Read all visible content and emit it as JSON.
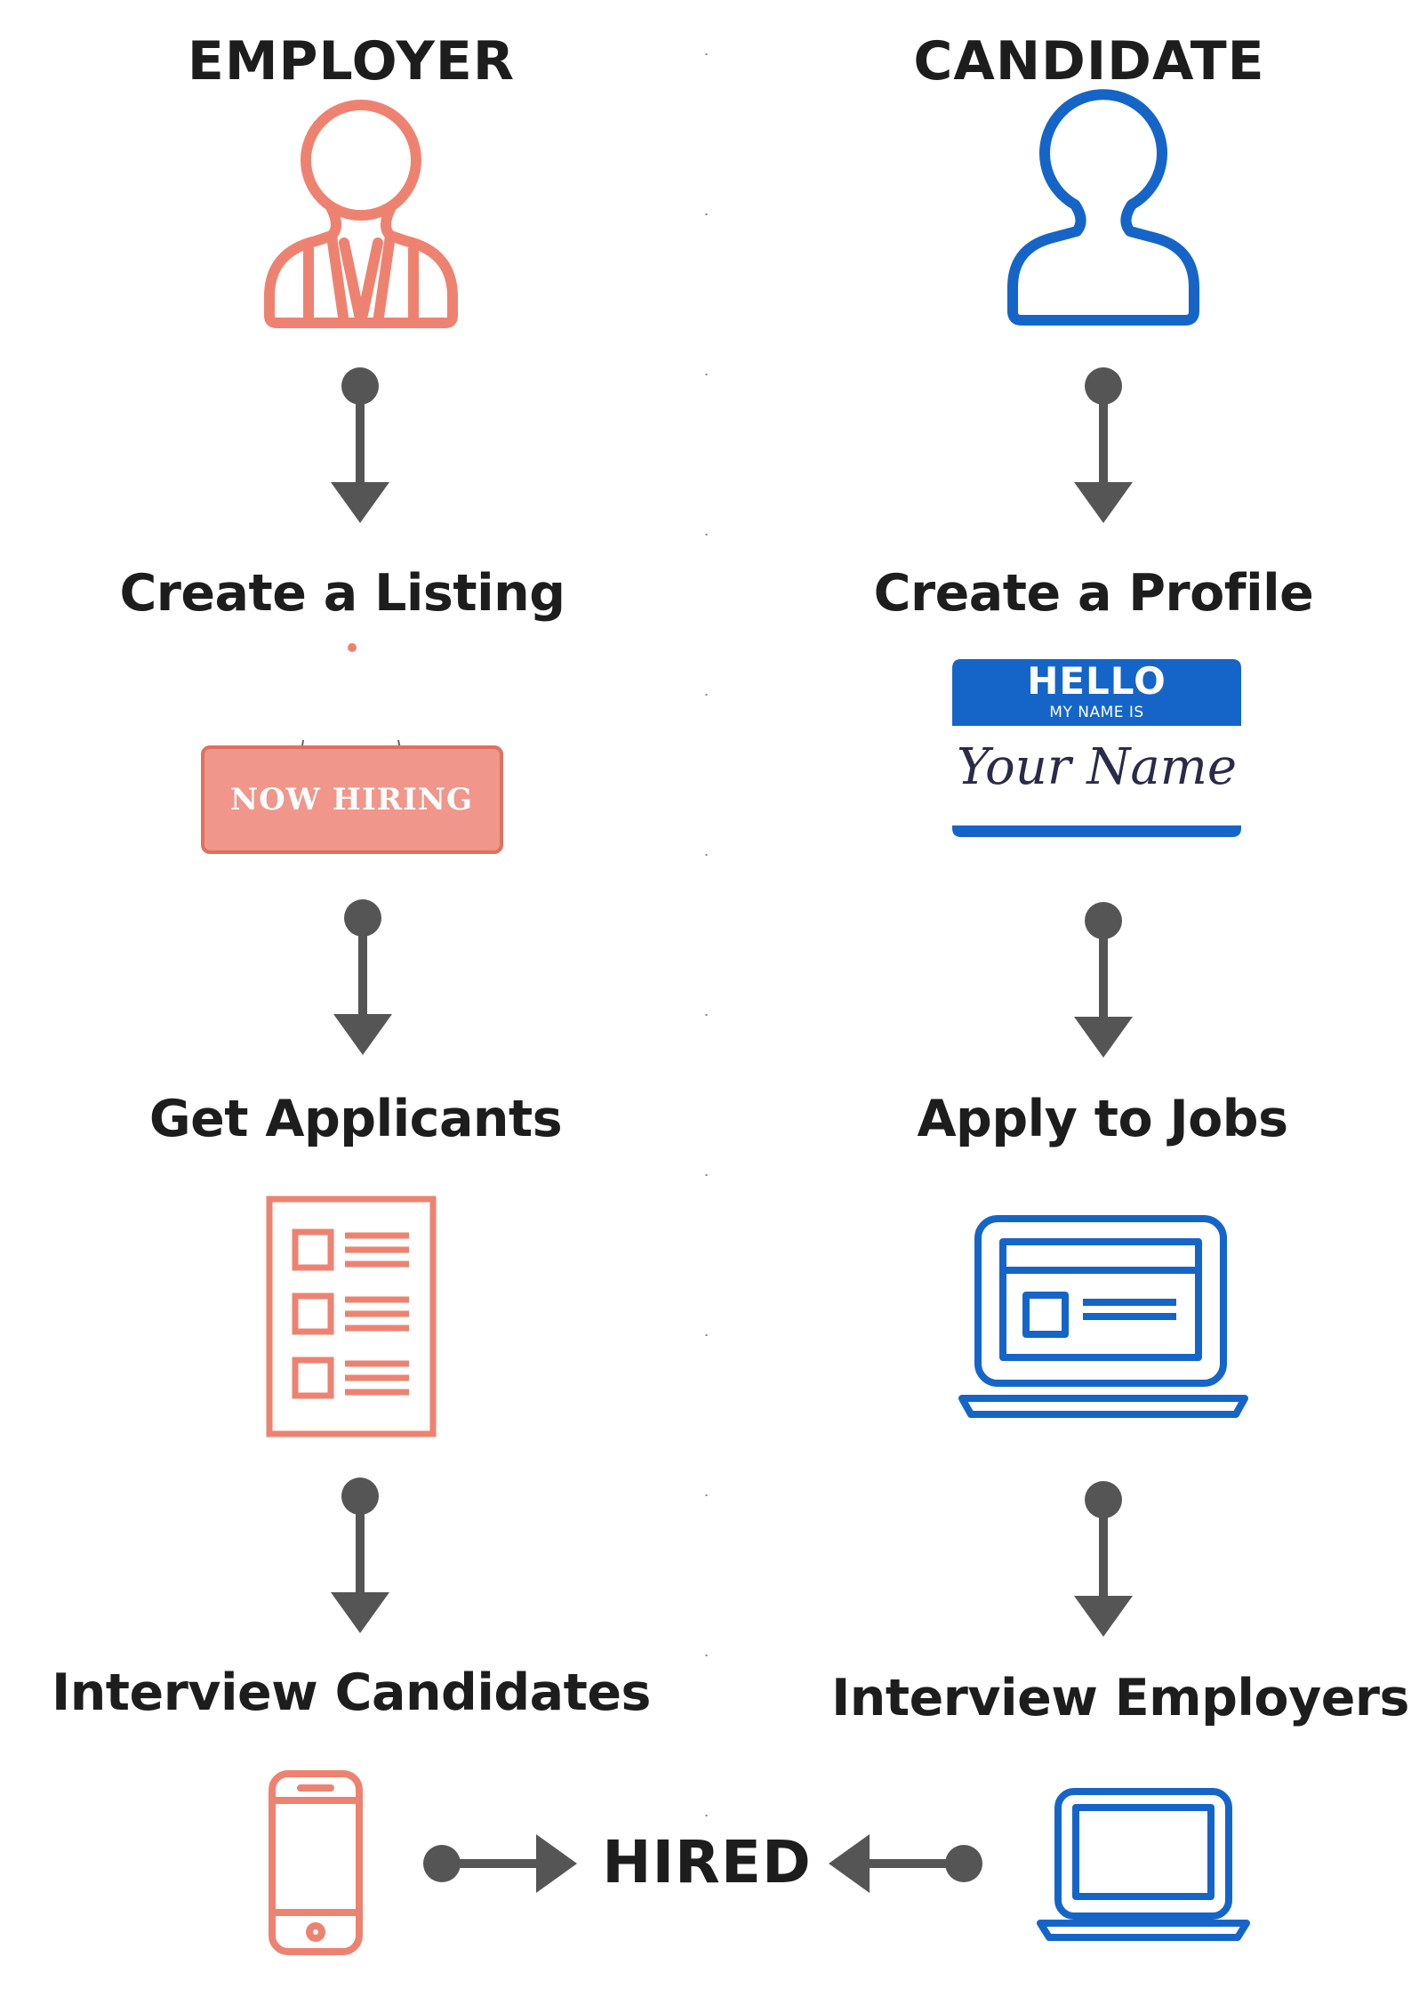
{
  "columns": {
    "employer": {
      "title": "EMPLOYER",
      "steps": [
        "Create a Listing",
        "Get Applicants",
        "Interview Candidates"
      ],
      "color": "#ee8270"
    },
    "candidate": {
      "title": "CANDIDATE",
      "steps": [
        "Create a Profile",
        "Apply to Jobs",
        "Interview Employers"
      ],
      "color": "#1565c8"
    }
  },
  "sign": {
    "text": "NOW HIRING",
    "fill": "#f0968a"
  },
  "name_tag": {
    "hello": "HELLO",
    "subtitle": "MY NAME IS",
    "name": "Your Name"
  },
  "outcome": {
    "label": "HIRED"
  },
  "colors": {
    "arrow": "#555555",
    "text": "#1d1d1d"
  },
  "icons": [
    "employer-person-icon",
    "candidate-person-icon",
    "arrow-down-icon",
    "application-form-icon",
    "laptop-browser-icon",
    "smartphone-icon",
    "laptop-icon",
    "arrow-right-icon",
    "arrow-left-icon"
  ]
}
